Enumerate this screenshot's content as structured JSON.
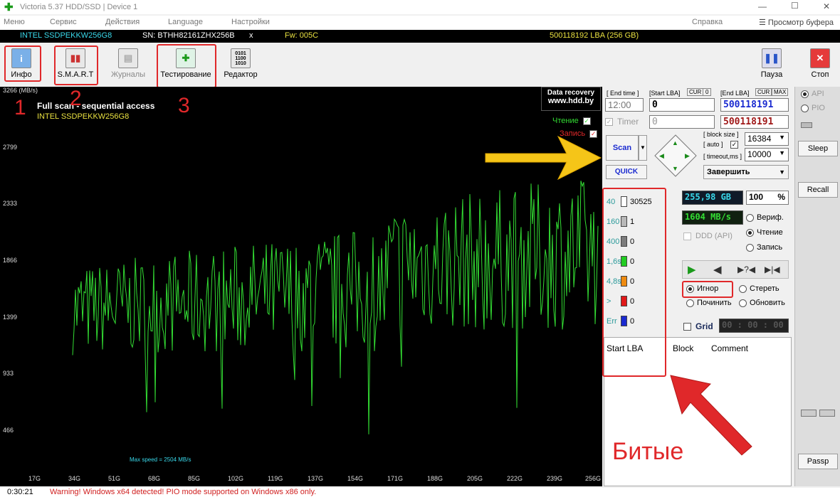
{
  "window": {
    "title": "Victoria 5.37 HDD/SSD | Device 1",
    "controls": [
      "—",
      "☐",
      "✕"
    ]
  },
  "menu": {
    "items": [
      "Меню",
      "Сервис",
      "Действия",
      "Language",
      "Настройки",
      "Справка"
    ],
    "buffer_view": "Просмотр буфера"
  },
  "device": {
    "model": "INTEL SSDPEKKW256G8",
    "serial": "SN: BTHH82161ZHX256B",
    "close": "x",
    "firmware": "Fw: 005C",
    "capacity": "500118192 LBA (256 GB)"
  },
  "toolbar": {
    "info": "Инфо",
    "smart": "S.M.A.R.T",
    "logs": "Журналы",
    "testing": "Тестирование",
    "editor": "Редактор",
    "pause": "Пауза",
    "stop": "Стоп"
  },
  "annotations": {
    "n1": "1",
    "n2": "2",
    "n3": "3",
    "bad": "Битые"
  },
  "graph": {
    "title": "Full scan - sequential access",
    "drive": "INTEL SSDPEKKW256G8",
    "logo_line1": "Data recovery",
    "logo_line2": "www.hdd.by",
    "read_label": "Чтение",
    "write_label": "Запись",
    "unit": "3266 (MB/s)",
    "y_ticks": [
      "2799",
      "2333",
      "1866",
      "1399",
      "933",
      "466"
    ],
    "x_ticks": [
      "17G",
      "34G",
      "51G",
      "68G",
      "85G",
      "102G",
      "119G",
      "137G",
      "154G",
      "171G",
      "188G",
      "205G",
      "222G",
      "239G",
      "256G"
    ],
    "max_speed": "Max speed = 2504 MB/s"
  },
  "controls": {
    "end_time_label": "[ End time ]",
    "end_time": "12:00",
    "start_lba_label": "[Start LBA]",
    "cur": "CUR",
    "zero": "0",
    "start_lba": "0",
    "timer_label": "Timer",
    "timer_value": "0",
    "end_lba_label": "[End LBA]",
    "max": "MAX",
    "end_lba": "500118191",
    "end_lba2": "500118191",
    "scan": "Scan",
    "quick": "QUICK",
    "block_size_label": "[ block size ]",
    "auto_label": "[ auto ]",
    "timeout_label": "[ timeout,ms ]",
    "block_size": "16384",
    "timeout": "10000",
    "finish": "Завершить",
    "size": "255,98 GB",
    "percent": "100",
    "percent_sign": "%",
    "speed": "1604 MB/s",
    "ddd": "DDD (API)",
    "verify": "Вериф.",
    "read": "Чтение",
    "write": "Запись",
    "ignore": "Игнор",
    "erase": "Стереть",
    "repair": "Починить",
    "refresh": "Обновить",
    "grid": "Grid",
    "clock": "00 : 00 : 00"
  },
  "legend": [
    {
      "label": "40",
      "count": "30525",
      "color": "#ffffff"
    },
    {
      "label": "160",
      "count": "1",
      "color": "#b8b8b8"
    },
    {
      "label": "400",
      "count": "0",
      "color": "#7c7c7c"
    },
    {
      "label": "1,6s",
      "count": "0",
      "color": "#22cc22"
    },
    {
      "label": "4,8s",
      "count": "0",
      "color": "#ee8a10"
    },
    {
      "label": ">",
      "count": "0",
      "color": "#e01818"
    },
    {
      "label": "Err",
      "count": "0",
      "color": "#1a2ad0"
    }
  ],
  "table": {
    "headers": [
      "Start LBA",
      "Block",
      "Comment"
    ]
  },
  "side": {
    "api": "API",
    "pio": "PIO",
    "sleep": "Sleep",
    "recall": "Recall",
    "passp": "Passp"
  },
  "status": {
    "time": "0:30:21",
    "message": "Warning! Windows x64 detected! PIO mode supported on Windows x86 only."
  },
  "colors": {
    "accent_red": "#e0282a",
    "graph_line": "#33dd33",
    "cyan_text": "#39d8ea",
    "arrow_yellow": "#f5c518"
  }
}
